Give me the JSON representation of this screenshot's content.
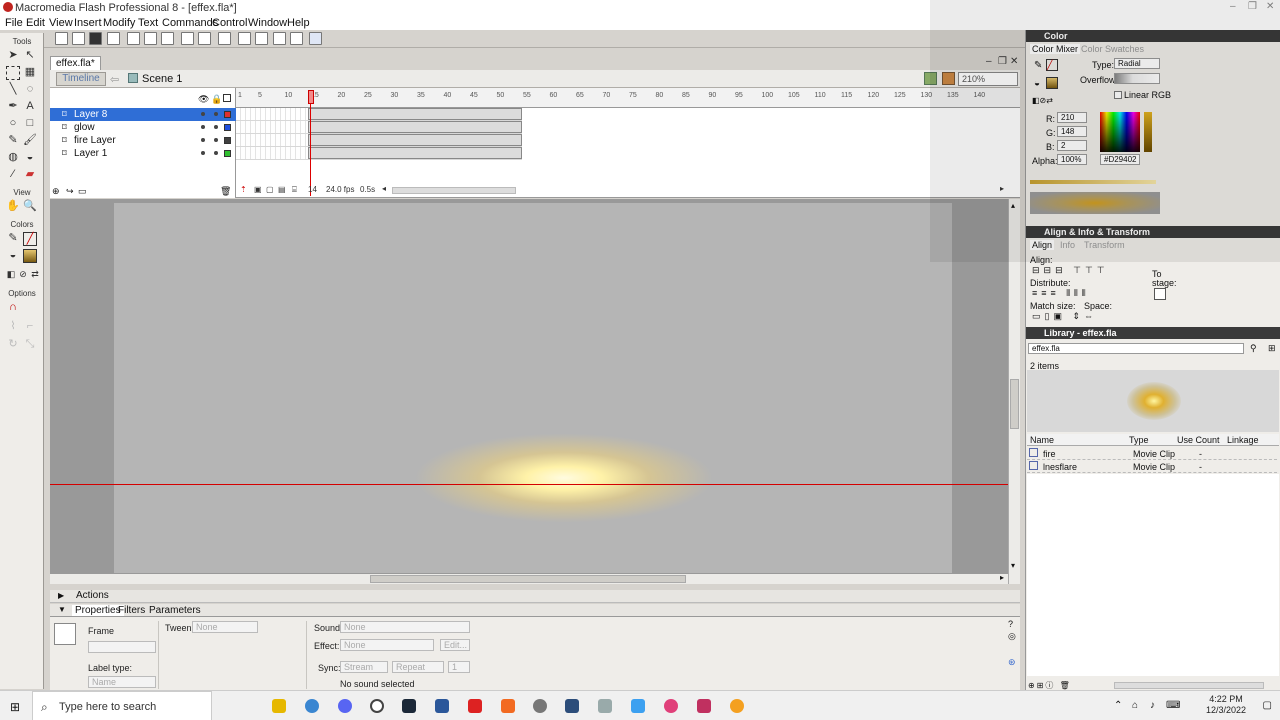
{
  "window": {
    "title": "Macromedia Flash Professional 8 - [effex.fla*]",
    "controls": [
      "–",
      "❐",
      "✕"
    ]
  },
  "menu": [
    "File",
    "Edit",
    "View",
    "Insert",
    "Modify",
    "Text",
    "Commands",
    "Control",
    "Window",
    "Help"
  ],
  "tools": {
    "label": "Tools",
    "view_label": "View",
    "colors_label": "Colors",
    "options_label": "Options"
  },
  "document": {
    "tab": "effex.fla*",
    "doc_controls": [
      "–",
      "❐",
      "✕"
    ],
    "timeline_btn": "Timeline",
    "scene": "Scene 1",
    "zoom": "210%"
  },
  "timeline": {
    "layers": [
      {
        "name": "Layer 8",
        "selected": true,
        "color": "#e03030"
      },
      {
        "name": "glow",
        "selected": false,
        "color": "#2050e0"
      },
      {
        "name": "fire Layer",
        "selected": false,
        "color": "#404040"
      },
      {
        "name": "Layer 1",
        "selected": false,
        "color": "#30c030"
      }
    ],
    "ruler": [
      "1",
      "5",
      "10",
      "15",
      "20",
      "25",
      "30",
      "35",
      "40",
      "45",
      "50",
      "55",
      "60",
      "65",
      "70",
      "75",
      "80",
      "85",
      "90",
      "95",
      "100",
      "105",
      "110",
      "115",
      "120",
      "125",
      "130",
      "135",
      "140"
    ],
    "current_frame": "14",
    "fps": "24.0 fps",
    "time": "0.5s"
  },
  "panels": {
    "actions": "Actions",
    "tabs": [
      "Properties",
      "Filters",
      "Parameters"
    ],
    "props": {
      "frame_label": "Frame",
      "tween_label": "Tween:",
      "tween_value": "None",
      "sound_label": "Sound:",
      "sound_value": "None",
      "effect_label": "Effect:",
      "effect_value": "None",
      "edit_btn": "Edit...",
      "sync_label": "Sync:",
      "sync_value": "Stream",
      "repeat_value": "Repeat",
      "repeat_count": "1",
      "label_type_label": "Label type:",
      "label_type_value": "Name",
      "no_sound": "No sound selected"
    }
  },
  "color": {
    "head": "Color",
    "tabs": [
      "Color Mixer",
      "Color Swatches"
    ],
    "type_label": "Type:",
    "type_value": "Radial",
    "overflow_label": "Overflow:",
    "linear_rgb": "Linear RGB",
    "r_label": "R:",
    "r": "210",
    "g_label": "G:",
    "g": "148",
    "b_label": "B:",
    "b": "2",
    "alpha_label": "Alpha:",
    "alpha": "100%",
    "hex": "#D29402",
    "selected_color": "#d29402"
  },
  "align": {
    "head": "Align & Info & Transform",
    "tabs": [
      "Align",
      "Info",
      "Transform"
    ],
    "align_label": "Align:",
    "distribute_label": "Distribute:",
    "match_label": "Match size:",
    "space_label": "Space:",
    "to_stage": "To stage:"
  },
  "library": {
    "head": "Library - effex.fla",
    "dropdown": "effex.fla",
    "count": "2 items",
    "columns": [
      "Name",
      "Type",
      "Use Count",
      "Linkage"
    ],
    "items": [
      {
        "name": "fire",
        "type": "Movie Clip",
        "use": "-"
      },
      {
        "name": "lnesflare",
        "type": "Movie Clip",
        "use": "-"
      }
    ]
  },
  "taskbar": {
    "search": "Type here to search",
    "time": "4:22 PM",
    "date": "12/3/2022"
  }
}
